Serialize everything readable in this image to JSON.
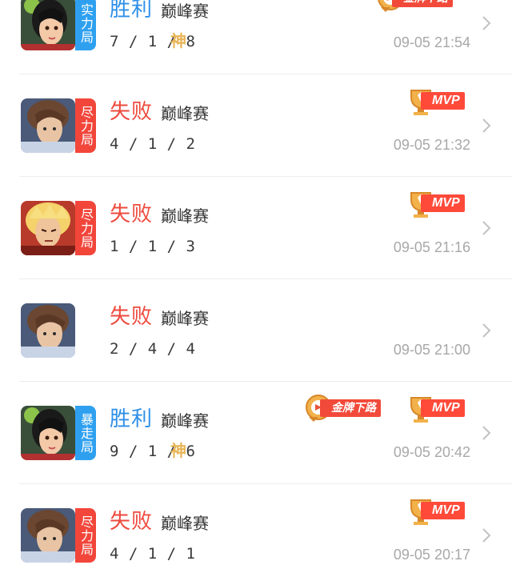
{
  "matches": [
    {
      "badge": "实力局",
      "badge_color": "#2fa0f0",
      "result": "胜利",
      "result_type": "win",
      "mode": "巅峰赛",
      "kda": "7 / 1 / 8",
      "god": "神",
      "time": "09-05 21:54",
      "medals": [
        {
          "label": "金牌下路",
          "kind": "lane"
        }
      ]
    },
    {
      "badge": "尽力局",
      "badge_color": "#f2463b",
      "result": "失败",
      "result_type": "lose",
      "mode": "巅峰赛",
      "kda": "4 / 1 / 2",
      "god": "",
      "time": "09-05 21:32",
      "medals": [
        {
          "label": "MVP",
          "kind": "mvp"
        }
      ]
    },
    {
      "badge": "尽力局",
      "badge_color": "#f2463b",
      "result": "失败",
      "result_type": "lose",
      "mode": "巅峰赛",
      "kda": "1 / 1 / 3",
      "god": "",
      "time": "09-05 21:16",
      "medals": [
        {
          "label": "MVP",
          "kind": "mvp"
        }
      ]
    },
    {
      "badge": "",
      "badge_color": "",
      "result": "失败",
      "result_type": "lose",
      "mode": "巅峰赛",
      "kda": "2 / 4 / 4",
      "god": "",
      "time": "09-05 21:00",
      "medals": []
    },
    {
      "badge": "暴走局",
      "badge_color": "#2fa0f0",
      "result": "胜利",
      "result_type": "win",
      "mode": "巅峰赛",
      "kda": "9 / 1 / 6",
      "god": "神",
      "time": "09-05 20:42",
      "medals": [
        {
          "label": "金牌下路",
          "kind": "lane"
        },
        {
          "label": "MVP",
          "kind": "mvp"
        }
      ]
    },
    {
      "badge": "尽力局",
      "badge_color": "#f2463b",
      "result": "失败",
      "result_type": "lose",
      "mode": "巅峰赛",
      "kda": "4 / 1 / 1",
      "god": "",
      "time": "09-05 20:17",
      "medals": [
        {
          "label": "MVP",
          "kind": "mvp"
        }
      ]
    }
  ],
  "icons": {
    "chevron": "chevron-right-icon",
    "medal": "trophy-medal-icon"
  }
}
